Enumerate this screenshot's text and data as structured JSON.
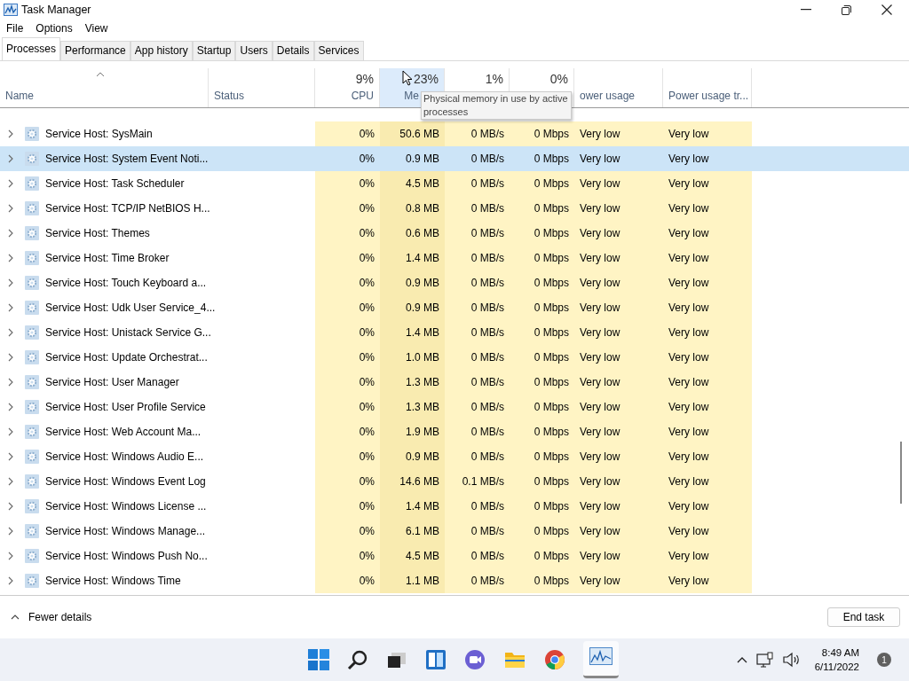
{
  "window": {
    "title": "Task Manager"
  },
  "menu": [
    "File",
    "Options",
    "View"
  ],
  "tabs": [
    {
      "label": "Processes",
      "selected": true
    },
    {
      "label": "Performance",
      "selected": false
    },
    {
      "label": "App history",
      "selected": false
    },
    {
      "label": "Startup",
      "selected": false
    },
    {
      "label": "Users",
      "selected": false
    },
    {
      "label": "Details",
      "selected": false
    },
    {
      "label": "Services",
      "selected": false
    }
  ],
  "table": {
    "columns": [
      {
        "label": "Name",
        "hovered": false
      },
      {
        "label": "Status",
        "hovered": false
      },
      {
        "label": "CPU",
        "value": "9%",
        "hovered": false
      },
      {
        "label": "Me",
        "value": "23%",
        "hovered": true
      },
      {
        "value": "1%",
        "hovered": false
      },
      {
        "value": "0%",
        "hovered": false
      },
      {
        "label": "ower usage",
        "hovered": false
      },
      {
        "label": "Power usage tr...",
        "hovered": false
      }
    ],
    "tooltip": "Physical memory in use by active processes",
    "rows": [
      {
        "selected": false,
        "cells": [
          "Service Host: SysMain",
          "",
          "0%",
          "50.6 MB",
          "0 MB/s",
          "0 Mbps",
          "Very low",
          "Very low"
        ]
      },
      {
        "selected": true,
        "cells": [
          "Service Host: System Event Noti...",
          "",
          "0%",
          "0.9 MB",
          "0 MB/s",
          "0 Mbps",
          "Very low",
          "Very low"
        ]
      },
      {
        "selected": false,
        "cells": [
          "Service Host: Task Scheduler",
          "",
          "0%",
          "4.5 MB",
          "0 MB/s",
          "0 Mbps",
          "Very low",
          "Very low"
        ]
      },
      {
        "selected": false,
        "cells": [
          "Service Host: TCP/IP NetBIOS H...",
          "",
          "0%",
          "0.8 MB",
          "0 MB/s",
          "0 Mbps",
          "Very low",
          "Very low"
        ]
      },
      {
        "selected": false,
        "cells": [
          "Service Host: Themes",
          "",
          "0%",
          "0.6 MB",
          "0 MB/s",
          "0 Mbps",
          "Very low",
          "Very low"
        ]
      },
      {
        "selected": false,
        "cells": [
          "Service Host: Time Broker",
          "",
          "0%",
          "1.4 MB",
          "0 MB/s",
          "0 Mbps",
          "Very low",
          "Very low"
        ]
      },
      {
        "selected": false,
        "cells": [
          "Service Host: Touch Keyboard a...",
          "",
          "0%",
          "0.9 MB",
          "0 MB/s",
          "0 Mbps",
          "Very low",
          "Very low"
        ]
      },
      {
        "selected": false,
        "cells": [
          "Service Host: Udk User Service_4...",
          "",
          "0%",
          "0.9 MB",
          "0 MB/s",
          "0 Mbps",
          "Very low",
          "Very low"
        ]
      },
      {
        "selected": false,
        "cells": [
          "Service Host: Unistack Service G...",
          "",
          "0%",
          "1.4 MB",
          "0 MB/s",
          "0 Mbps",
          "Very low",
          "Very low"
        ]
      },
      {
        "selected": false,
        "cells": [
          "Service Host: Update Orchestrat...",
          "",
          "0%",
          "1.0 MB",
          "0 MB/s",
          "0 Mbps",
          "Very low",
          "Very low"
        ]
      },
      {
        "selected": false,
        "cells": [
          "Service Host: User Manager",
          "",
          "0%",
          "1.3 MB",
          "0 MB/s",
          "0 Mbps",
          "Very low",
          "Very low"
        ]
      },
      {
        "selected": false,
        "cells": [
          "Service Host: User Profile Service",
          "",
          "0%",
          "1.3 MB",
          "0 MB/s",
          "0 Mbps",
          "Very low",
          "Very low"
        ]
      },
      {
        "selected": false,
        "cells": [
          "Service Host: Web Account Ma...",
          "",
          "0%",
          "1.9 MB",
          "0 MB/s",
          "0 Mbps",
          "Very low",
          "Very low"
        ]
      },
      {
        "selected": false,
        "cells": [
          "Service Host: Windows Audio E...",
          "",
          "0%",
          "0.9 MB",
          "0 MB/s",
          "0 Mbps",
          "Very low",
          "Very low"
        ]
      },
      {
        "selected": false,
        "cells": [
          "Service Host: Windows Event Log",
          "",
          "0%",
          "14.6 MB",
          "0.1 MB/s",
          "0 Mbps",
          "Very low",
          "Very low"
        ]
      },
      {
        "selected": false,
        "cells": [
          "Service Host: Windows License ...",
          "",
          "0%",
          "1.4 MB",
          "0 MB/s",
          "0 Mbps",
          "Very low",
          "Very low"
        ]
      },
      {
        "selected": false,
        "cells": [
          "Service Host: Windows Manage...",
          "",
          "0%",
          "6.1 MB",
          "0 MB/s",
          "0 Mbps",
          "Very low",
          "Very low"
        ]
      },
      {
        "selected": false,
        "cells": [
          "Service Host: Windows Push No...",
          "",
          "0%",
          "4.5 MB",
          "0 MB/s",
          "0 Mbps",
          "Very low",
          "Very low"
        ]
      },
      {
        "selected": false,
        "cells": [
          "Service Host: Windows Time",
          "",
          "0%",
          "1.1 MB",
          "0 MB/s",
          "0 Mbps",
          "Very low",
          "Very low"
        ]
      }
    ]
  },
  "footer": {
    "details_link": "Fewer details",
    "end_task": "End task"
  },
  "taskbar": {
    "time": "8:49 AM",
    "date": "6/11/2022",
    "notifications": "1"
  }
}
